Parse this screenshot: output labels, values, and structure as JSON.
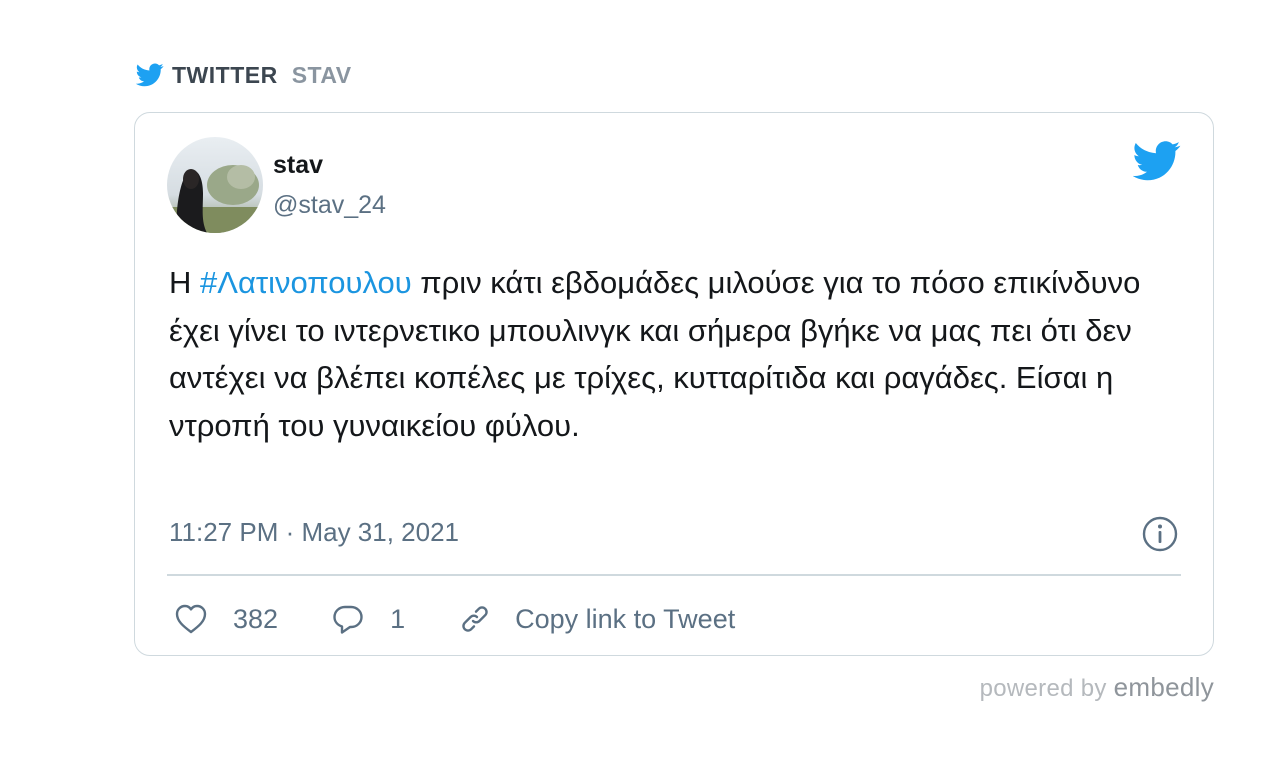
{
  "source": {
    "brand": "TWITTER",
    "author": "STAV",
    "icon": "twitter-bird-icon"
  },
  "tweet": {
    "display_name": "stav",
    "handle": "@stav_24",
    "text_before_hashtag": "Η ",
    "hashtag": "#Λατινοπουλου",
    "text_after_hashtag": " πριν κάτι εβδομάδες μιλούσε για το πόσο επικίνδυνο έχει γίνει το ιντερνετικο μπουλινγκ και σήμερα βγήκε να μας πει ότι δεν αντέχει να βλέπει κοπέλες με τρίχες, κυτταρίτιδα και ραγάδες. Είσαι η ντροπή του γυναικείου φύλου.",
    "timestamp": "11:27 PM · May 31, 2021",
    "likes": "382",
    "replies": "1",
    "copy_link_label": "Copy link to Tweet"
  },
  "footer": {
    "powered_by": "powered by",
    "brand": "embedly"
  },
  "colors": {
    "twitter_blue": "#1da1f2",
    "hashtag": "#1b95e0",
    "secondary_text": "#5b7083",
    "border": "#cfd9de"
  }
}
